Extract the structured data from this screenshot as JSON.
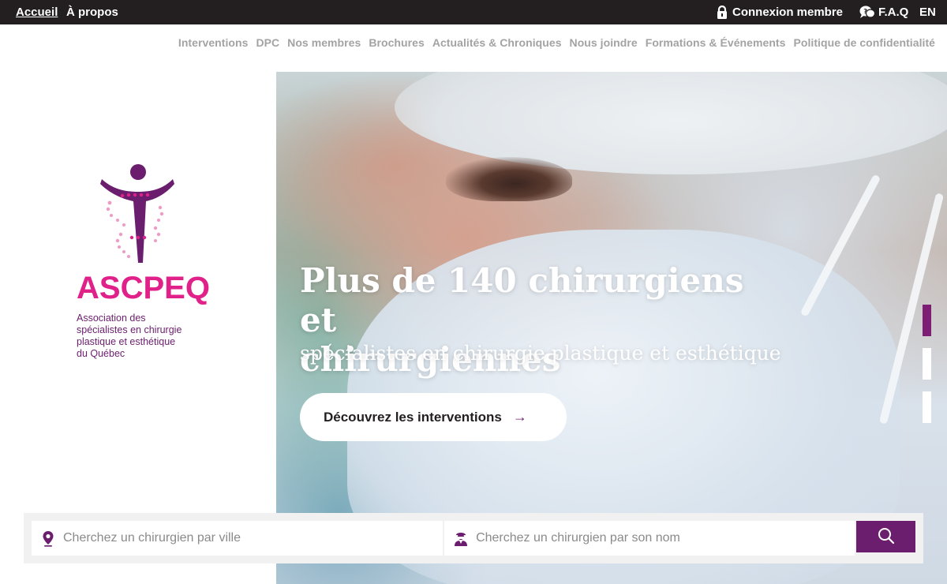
{
  "topbar": {
    "home_label": "Accueil",
    "about_label": "À propos",
    "login_label": "Connexion membre",
    "faq_label": "F.A.Q",
    "lang_label": "EN"
  },
  "nav": {
    "items": [
      {
        "label": "Interventions"
      },
      {
        "label": "DPC"
      },
      {
        "label": "Nos membres"
      },
      {
        "label": "Brochures"
      },
      {
        "label": "Actualités & Chroniques"
      },
      {
        "label": "Nous joindre"
      },
      {
        "label": "Formations & Événements"
      },
      {
        "label": "Politique de confidentialité"
      }
    ]
  },
  "logo": {
    "wordmark": "ASCPEQ",
    "tagline_1": "Association des",
    "tagline_2": "spécialistes en chirurgie",
    "tagline_3": "plastique et esthétique",
    "tagline_4": "du Québec"
  },
  "hero": {
    "headline_1": "Plus de 140 chirurgiens et",
    "headline_2": "chirurgiennes",
    "subline": "spécialistes en chirurgie plastique et esthétique",
    "cta_label": "Découvrez les interventions",
    "cta_arrow": "→",
    "slides_total": 3,
    "slide_active": 1
  },
  "search": {
    "city_placeholder": "Cherchez un chirurgien par ville",
    "name_placeholder": "Cherchez un chirurgien par son nom"
  },
  "colors": {
    "brand_purple": "#6b1d6e",
    "brand_pink": "#e0218a",
    "topbar_bg": "#231f20",
    "nav_text": "#a3a3a3"
  },
  "icons": {
    "login": "lock-icon",
    "faq": "faq-bubble-icon",
    "city": "map-pin-icon",
    "name": "surgeon-icon",
    "submit": "search-icon"
  }
}
